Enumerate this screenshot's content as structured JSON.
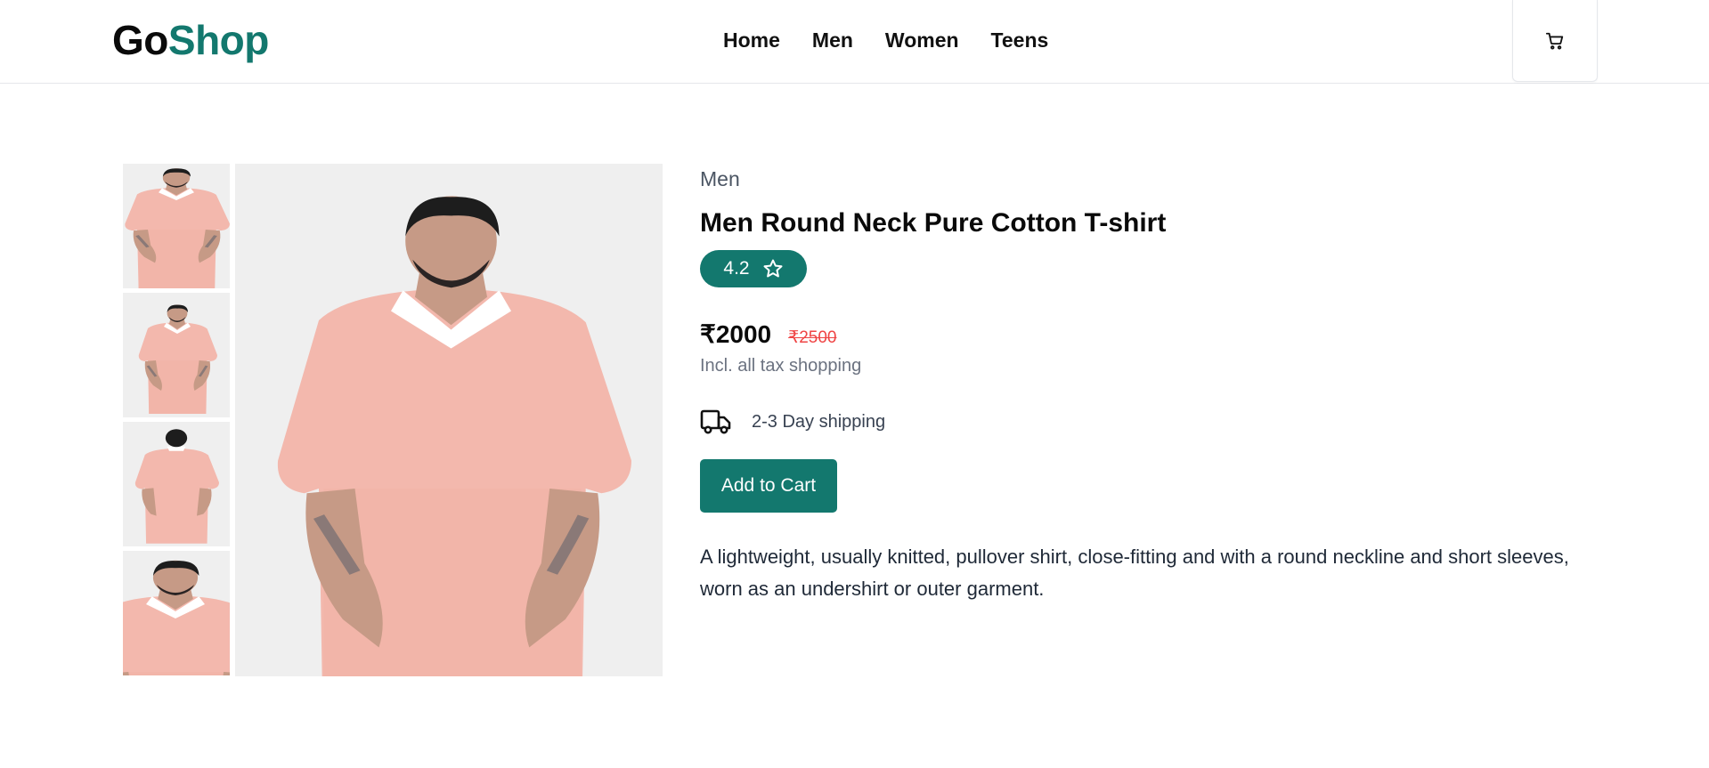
{
  "brand": {
    "part1": "Go",
    "part2": "Shop"
  },
  "nav": [
    {
      "label": "Home"
    },
    {
      "label": "Men"
    },
    {
      "label": "Women"
    },
    {
      "label": "Teens"
    }
  ],
  "cart": {
    "icon": "cart-icon"
  },
  "product": {
    "category": "Men",
    "title": "Men Round Neck Pure Cotton T-shirt",
    "rating": "4.2",
    "price": "₹2000",
    "old_price": "₹2500",
    "tax_note": "Incl. all tax shopping",
    "shipping": "2-3 Day shipping",
    "add_to_cart_label": "Add to Cart",
    "description": "A lightweight, usually knitted, pullover shirt, close-fitting and with a round neckline and short sleeves, worn as an undershirt or outer garment."
  },
  "gallery": {
    "thumbnails": [
      "front-view",
      "side-view",
      "back-view",
      "closeup-view"
    ],
    "main": "front-view"
  },
  "colors": {
    "accent": "#13786e",
    "shirt": "#f3b8ad",
    "old_price": "#ef4444"
  }
}
